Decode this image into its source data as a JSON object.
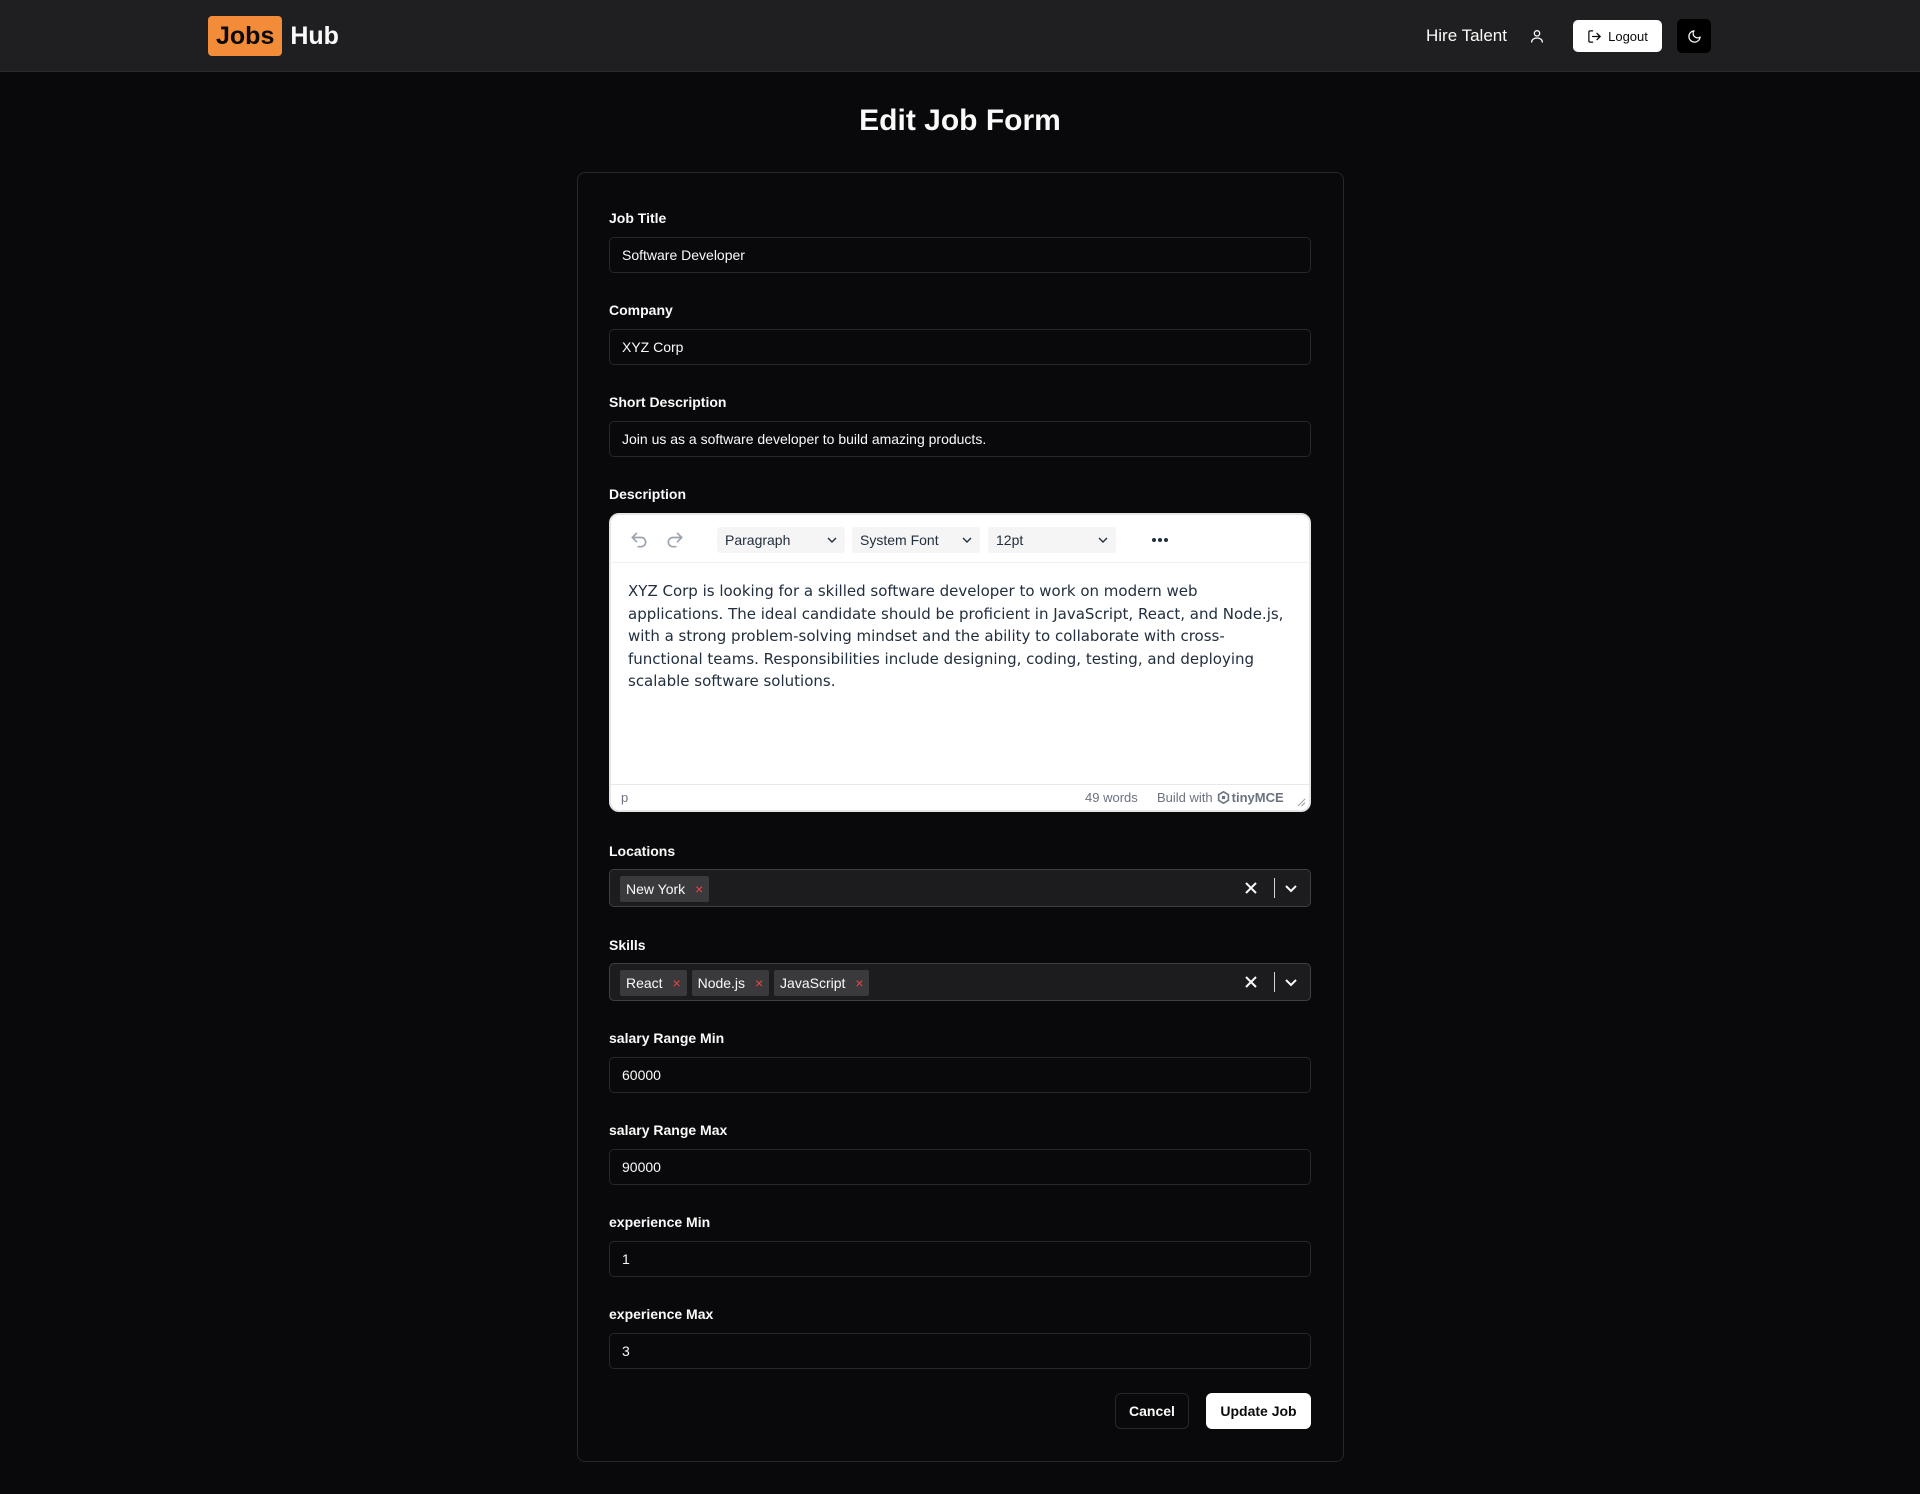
{
  "header": {
    "logo_left": "Jobs",
    "logo_right": "Hub",
    "nav_link": "Hire Talent",
    "logout_label": "Logout",
    "user_icon": "user-icon",
    "logout_icon": "logout-icon",
    "theme_icon": "moon-icon"
  },
  "page": {
    "title": "Edit Job Form"
  },
  "form": {
    "job_title": {
      "label": "Job Title",
      "value": "Software Developer"
    },
    "company": {
      "label": "Company",
      "value": "XYZ Corp"
    },
    "short_description": {
      "label": "Short Description",
      "value": "Join us as a software developer to build amazing products."
    },
    "description": {
      "label": "Description",
      "toolbar": {
        "block_format": "Paragraph",
        "font_family": "System Font",
        "font_size": "12pt"
      },
      "content": "XYZ Corp is looking for a skilled software developer to work on modern web applications. The ideal candidate should be proficient in JavaScript, React, and Node.js, with a strong problem-solving mindset and the ability to collaborate with cross-functional teams. Responsibilities include designing, coding, testing, and deploying scalable software solutions.",
      "status": {
        "path": "p",
        "word_count": "49 words",
        "build_with": "Build with",
        "brand": "tinyMCE"
      }
    },
    "locations": {
      "label": "Locations",
      "tags": [
        "New York"
      ]
    },
    "skills": {
      "label": "Skills",
      "tags": [
        "React",
        "Node.js",
        "JavaScript"
      ]
    },
    "salary_min": {
      "label": "salary Range Min",
      "value": "60000"
    },
    "salary_max": {
      "label": "salary Range Max",
      "value": "90000"
    },
    "experience_min": {
      "label": "experience Min",
      "value": "1"
    },
    "experience_max": {
      "label": "experience Max",
      "value": "3"
    },
    "cancel_label": "Cancel",
    "submit_label": "Update Job"
  },
  "colors": {
    "brand": "#f28c38",
    "background": "#09090b",
    "header": "#1f1f21",
    "tag_remove": "#ef4444"
  }
}
